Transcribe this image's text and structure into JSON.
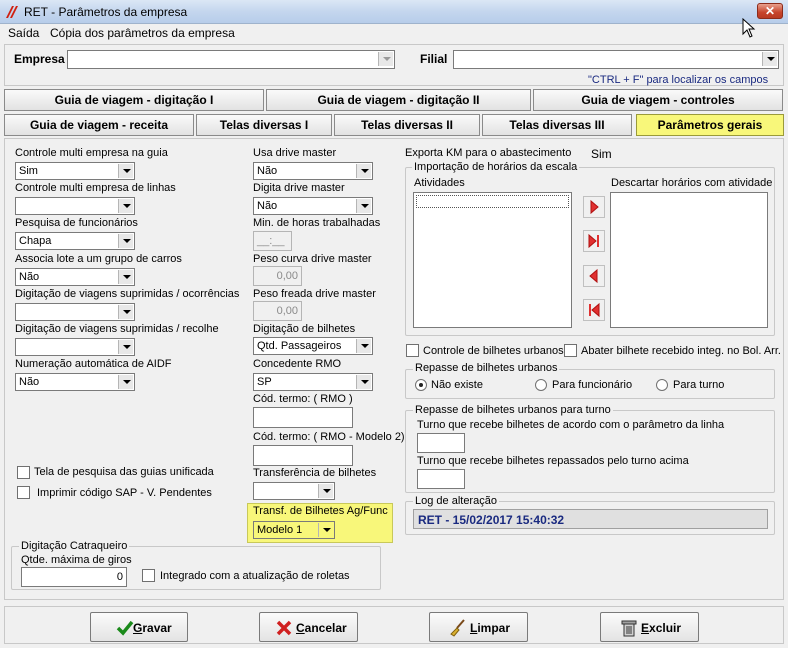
{
  "window": {
    "title": "RET - Parâmetros da empresa"
  },
  "menu": {
    "items": [
      "Saída",
      "Cópia dos parâmetros da empresa"
    ]
  },
  "header": {
    "empresa_label": "Empresa",
    "empresa_value": "",
    "filial_label": "Filial",
    "filial_value": "",
    "hint": "\"CTRL + F\" para localizar os campos"
  },
  "tabs": {
    "row1": [
      "Guia de viagem - digitação I",
      "Guia de viagem - digitação II",
      "Guia de viagem - controles"
    ],
    "row2": [
      "Guia de viagem - receita",
      "Telas diversas I",
      "Telas diversas II",
      "Telas diversas III",
      "Parâmetros gerais"
    ],
    "active": "Parâmetros gerais"
  },
  "left": {
    "controle_guia": {
      "label": "Controle multi empresa na guia",
      "value": "Sim"
    },
    "controle_linhas": {
      "label": "Controle multi empresa de linhas",
      "value": ""
    },
    "pesquisa_func": {
      "label": "Pesquisa de funcionários",
      "value": "Chapa"
    },
    "associa_lote": {
      "label": "Associa lote a um grupo de carros",
      "value": "Não"
    },
    "dig_ocorrencias": {
      "label": "Digitação de viagens suprimidas / ocorrências",
      "value": ""
    },
    "dig_recolhe": {
      "label": "Digitação de viagens suprimidas / recolhe",
      "value": ""
    },
    "numeracao_aidf": {
      "label": "Numeração automática de AIDF",
      "value": "Não"
    },
    "tela_pesquisa_chk": "Tela de pesquisa das guias unificada",
    "imprimir_sap_chk": "Imprimir código SAP - V. Pendentes"
  },
  "middle": {
    "usa_drive": {
      "label": "Usa drive master",
      "value": "Não"
    },
    "digita_drive": {
      "label": "Digita drive master",
      "value": "Não"
    },
    "min_horas": {
      "label": "Min. de horas trabalhadas",
      "value": "__:__"
    },
    "peso_curva": {
      "label": "Peso curva drive master",
      "value": "0,00"
    },
    "peso_freada": {
      "label": "Peso freada drive master",
      "value": "0,00"
    },
    "dig_bilhetes": {
      "label": "Digitação de bilhetes",
      "value": "Qtd. Passageiros"
    },
    "concedente": {
      "label": "Concedente RMO",
      "value": "SP"
    },
    "cod_termo": {
      "label": "Cód. termo: ( RMO )",
      "value": ""
    },
    "cod_termo2": {
      "label": "Cód. termo: ( RMO - Modelo 2)",
      "value": ""
    },
    "transf_bilhetes": {
      "label": "Transferência de bilhetes",
      "value": ""
    },
    "transf_ag": {
      "label": "Transf. de Bilhetes Ag/Func",
      "value": "Modelo 1"
    }
  },
  "catraqueiro": {
    "title": "Digitação Catraqueiro",
    "qtde_label": "Qtde. máxima de giros",
    "qtde_value": "0",
    "integrado_chk": "Integrado com a atualização de roletas"
  },
  "right": {
    "exporta_label": "Exporta KM para o abastecimento",
    "exporta_value": "Sim",
    "importacao_title": "Importação de horários da escala",
    "atividades_label": "Atividades",
    "descartar_label": "Descartar horários  com atividade",
    "controle_bilhetes_chk": "Controle de bilhetes urbanos",
    "abater_chk": "Abater bilhete recebido integ. no Bol. Arr.",
    "repasse_title": "Repasse de bilhetes urbanos",
    "repasse_options": [
      "Não existe",
      "Para funcionário",
      "Para turno"
    ],
    "repasse_selected": "Não existe",
    "repasse_turno_title": "Repasse de bilhetes urbanos para turno",
    "turno_recebe_label": "Turno que recebe bilhetes de acordo com o parâmetro da linha",
    "turno_repassados_label": "Turno que recebe bilhetes repassados pelo turno acima",
    "log_title": "Log de alteração",
    "log_value": "RET - 15/02/2017 15:40:32"
  },
  "buttons": {
    "gravar_u": "G",
    "gravar_rest": "ravar",
    "cancelar_u": "C",
    "cancelar_rest": "ancelar",
    "limpar_u": "L",
    "limpar_rest": "impar",
    "excluir_u": "E",
    "excluir_rest": "xcluir"
  },
  "colors": {
    "active_tab": "#f8f77a",
    "log_text": "#1a2a80",
    "hint_text": "#1a2a80"
  }
}
